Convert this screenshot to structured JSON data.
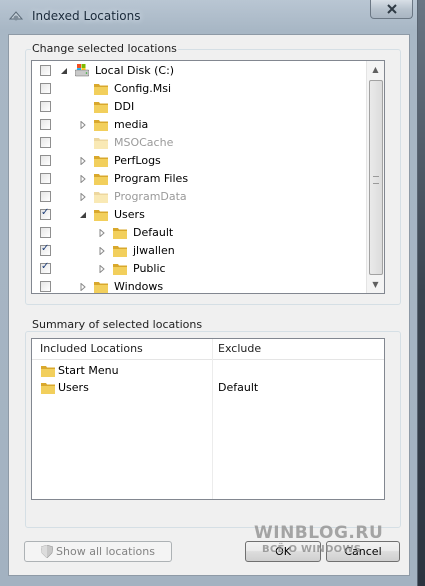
{
  "window": {
    "title": "Indexed Locations"
  },
  "change_group": {
    "label": "Change selected locations",
    "items": [
      {
        "label": "Local Disk (C:)",
        "checked": false,
        "expanded": true,
        "dim": false,
        "icon": "drive-icon"
      },
      {
        "label": "Config.Msi",
        "checked": false,
        "expanded": null,
        "dim": false,
        "icon": "folder-icon"
      },
      {
        "label": "DDI",
        "checked": false,
        "expanded": null,
        "dim": false,
        "icon": "folder-icon"
      },
      {
        "label": "media",
        "checked": false,
        "expanded": false,
        "dim": false,
        "icon": "folder-icon"
      },
      {
        "label": "MSOCache",
        "checked": false,
        "expanded": null,
        "dim": true,
        "icon": "folder-icon"
      },
      {
        "label": "PerfLogs",
        "checked": false,
        "expanded": false,
        "dim": false,
        "icon": "folder-icon"
      },
      {
        "label": "Program Files",
        "checked": false,
        "expanded": false,
        "dim": false,
        "icon": "folder-icon"
      },
      {
        "label": "ProgramData",
        "checked": false,
        "expanded": false,
        "dim": true,
        "icon": "folder-icon"
      },
      {
        "label": "Users",
        "checked": true,
        "expanded": true,
        "dim": false,
        "icon": "folder-icon"
      },
      {
        "label": "Default",
        "checked": false,
        "expanded": false,
        "dim": false,
        "icon": "folder-icon"
      },
      {
        "label": "jlwallen",
        "checked": true,
        "expanded": false,
        "dim": false,
        "icon": "folder-icon"
      },
      {
        "label": "Public",
        "checked": true,
        "expanded": false,
        "dim": false,
        "icon": "folder-icon"
      },
      {
        "label": "Windows",
        "checked": false,
        "expanded": false,
        "dim": false,
        "icon": "folder-icon"
      }
    ]
  },
  "summary_group": {
    "label": "Summary of selected locations",
    "columns": [
      "Included Locations",
      "Exclude"
    ],
    "rows": [
      {
        "included": "Start Menu",
        "exclude": ""
      },
      {
        "included": "Users",
        "exclude": "Default"
      }
    ]
  },
  "buttons": {
    "show_all": "Show all locations",
    "ok": "OK",
    "cancel": "Cancel"
  },
  "watermark": {
    "title": "WINBLOG.RU",
    "subtitle": "ВСЁ О WINDOWS"
  },
  "colors": {
    "folder_yellow": "#e8c044",
    "check_blue": "#1f3f7a",
    "window_frame": "#a8b7c5"
  }
}
